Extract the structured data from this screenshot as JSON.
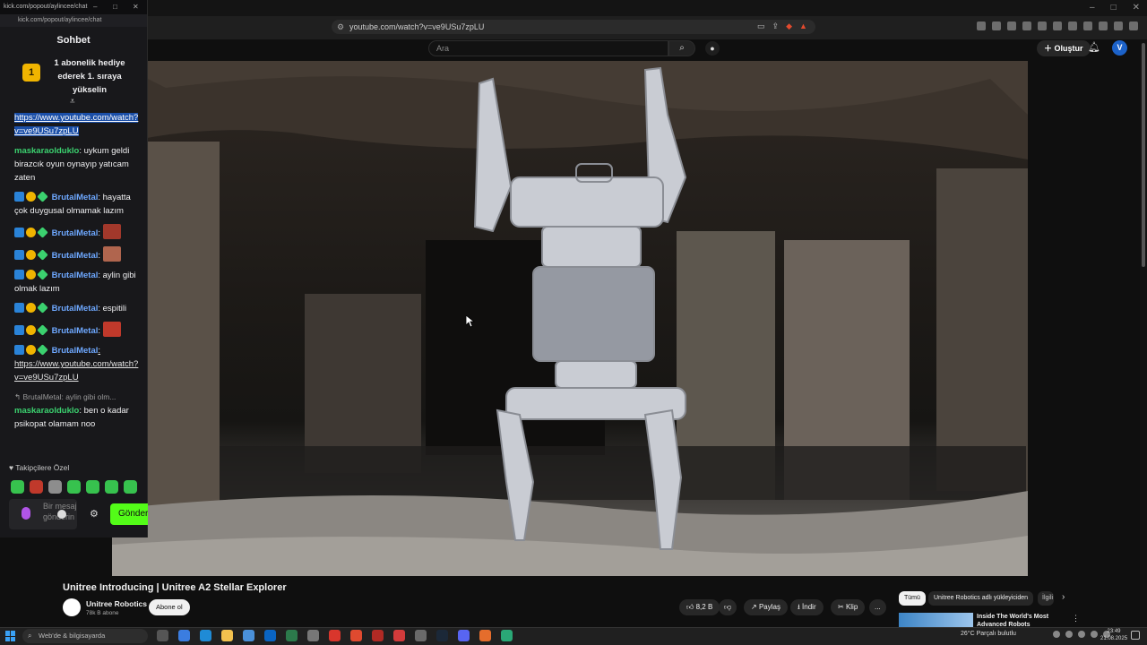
{
  "chat_window": {
    "url": "kick.com/popout/aylincee/chat",
    "title": "Sohbet",
    "gift_banner": {
      "rank": "1",
      "text": "1 abonelik hediye ederek 1. sıraya yükselin"
    },
    "messages": [
      {
        "user": "",
        "text": "https://www.youtube.com/watch?v=ve9USu7zpLU",
        "selected": true
      },
      {
        "user": "maskaraolduklo",
        "text": ": uykum geldi birazcık oyun oynayıp yatıcam zaten"
      },
      {
        "user": "BrutalMetal",
        "text": ": hayatta çok duygusal olmamak lazım"
      },
      {
        "user": "BrutalMetal",
        "text": ":",
        "emote": "red-face-emote"
      },
      {
        "user": "BrutalMetal",
        "text": ":",
        "emote": "face-emote"
      },
      {
        "user": "BrutalMetal",
        "text": ": aylin gibi olmak lazım"
      },
      {
        "user": "BrutalMetal",
        "text": ": espitili"
      },
      {
        "user": "BrutalMetal",
        "text": ":",
        "emote": "red-mask-emote"
      },
      {
        "user": "BrutalMetal",
        "text": ": https://www.youtube.com/watch?v=ve9USu7zpLU"
      }
    ],
    "reply_context": "BrutalMetal: aylin gibi olm...",
    "last_message": {
      "user": "maskaraolduklo",
      "text": ": ben o kadar psikopat olamam noo"
    },
    "followers_label": "Takipçilere Özel",
    "input_placeholder": "Bir mesaj gönderin",
    "send_label": "Gönder"
  },
  "browser": {
    "url": "youtube.com/watch?v=ve9USu7zpLU"
  },
  "youtube": {
    "search_placeholder": "Ara",
    "create_label": "Oluştur",
    "avatar_letter": "V",
    "video_title": "Unitree Introducing | Unitree A2 Stellar Explorer",
    "channel_name": "Unitree Robotics",
    "subscribers": "78k B abone",
    "subscribe_label": "Abone ol",
    "likes": "8,2 B",
    "share_label": "Paylaş",
    "download_label": "İndir",
    "clip_label": "Klip",
    "more_label": "...",
    "chips": [
      "Tümü",
      "Unitree Robotics adlı yükleyiciden",
      "İlgili"
    ],
    "recommended_title": "Inside The World's Most Advanced Robots"
  },
  "taskbar": {
    "search_placeholder": "Web'de & bilgisayarda",
    "weather": "26°C  Parçalı bulutlu",
    "time": "23:49",
    "date": "21.08.2025"
  }
}
